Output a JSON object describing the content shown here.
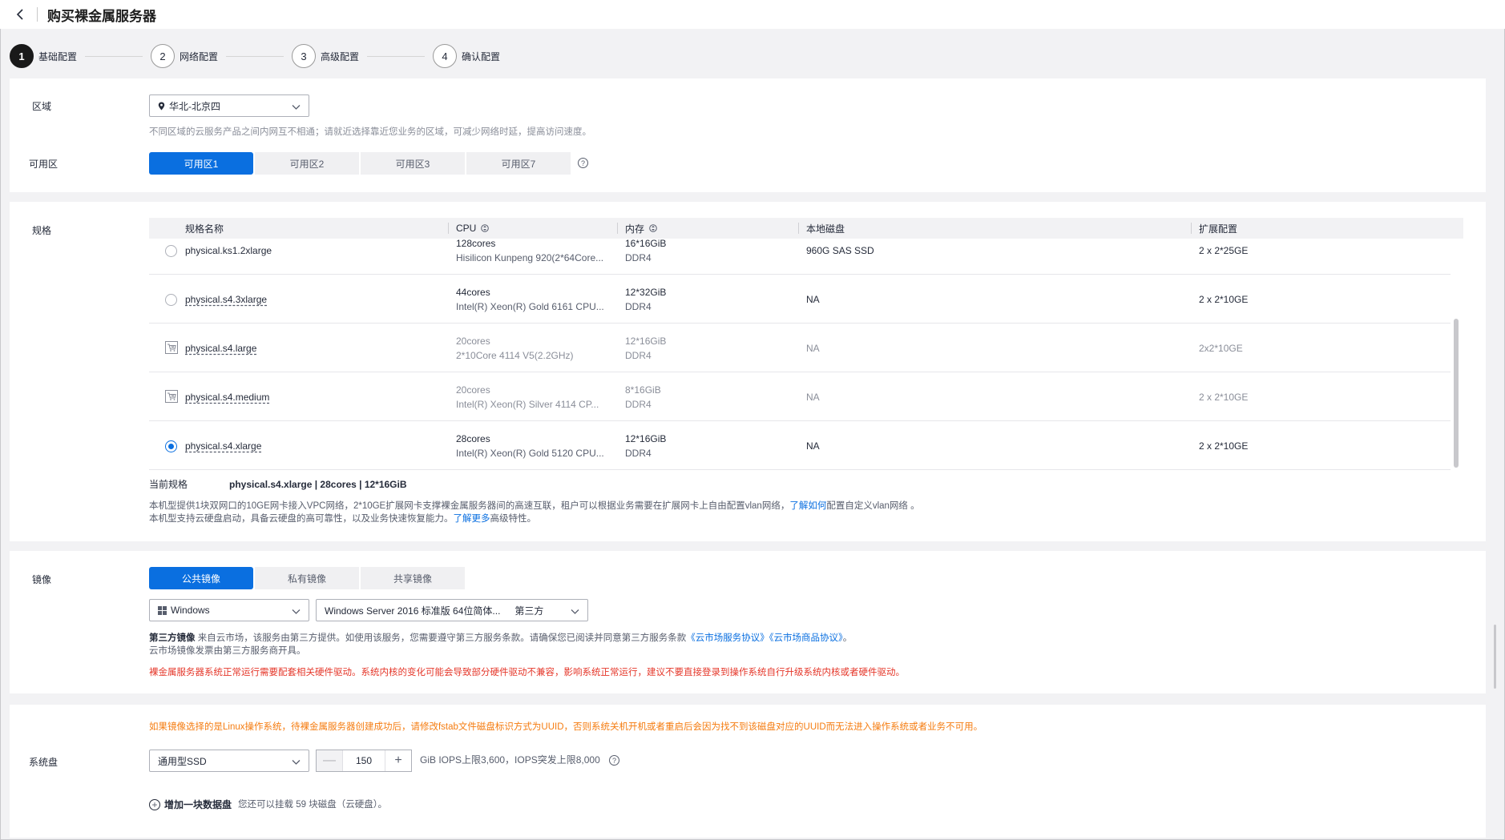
{
  "header": {
    "title": "购买裸金属服务器"
  },
  "steps": [
    {
      "num": "1",
      "label": "基础配置"
    },
    {
      "num": "2",
      "label": "网络配置"
    },
    {
      "num": "3",
      "label": "高级配置"
    },
    {
      "num": "4",
      "label": "确认配置"
    }
  ],
  "region": {
    "label": "区域",
    "value": "华北-北京四",
    "hint": "不同区域的云服务产品之间内网互不相通；请就近选择靠近您业务的区域，可减少网络时延，提高访问速度。"
  },
  "az": {
    "label": "可用区",
    "options": [
      "可用区1",
      "可用区2",
      "可用区3",
      "可用区7"
    ],
    "help": "?"
  },
  "spec": {
    "label": "规格",
    "columns": [
      "规格名称",
      "CPU",
      "内存",
      "本地磁盘",
      "扩展配置"
    ],
    "rows": [
      {
        "name": "physical.ks1.2xlarge",
        "cpu": "128cores",
        "cpu_sub": "Hisilicon Kunpeng 920(2*64Core...",
        "mem": "16*16GiB",
        "mem_sub": "DDR4",
        "disk": "960G SAS SSD",
        "ext": "2 x 2*25GE"
      },
      {
        "name": "physical.s4.3xlarge",
        "cpu": "44cores",
        "cpu_sub": "Intel(R) Xeon(R) Gold 6161 CPU...",
        "mem": "12*32GiB",
        "mem_sub": "DDR4",
        "disk": "NA",
        "ext": "2 x 2*10GE"
      },
      {
        "name": "physical.s4.large",
        "cpu": "20cores",
        "cpu_sub": "2*10Core 4114 V5(2.2GHz)",
        "mem": "12*16GiB",
        "mem_sub": "DDR4",
        "disk": "NA",
        "ext": "2x2*10GE"
      },
      {
        "name": "physical.s4.medium",
        "cpu": "20cores",
        "cpu_sub": "Intel(R) Xeon(R) Silver 4114 CP...",
        "mem": "8*16GiB",
        "mem_sub": "DDR4",
        "disk": "NA",
        "ext": "2 x 2*10GE"
      },
      {
        "name": "physical.s4.xlarge",
        "cpu": "28cores",
        "cpu_sub": "Intel(R) Xeon(R) Gold 5120 CPU...",
        "mem": "12*16GiB",
        "mem_sub": "DDR4",
        "disk": "NA",
        "ext": "2 x 2*10GE"
      }
    ],
    "current_label": "当前规格",
    "current_value": "physical.s4.xlarge | 28cores | 12*16GiB",
    "desc1_a": "本机型提供1块双网口的10GE网卡接入VPC网络，2*10GE扩展网卡支撑裸金属服务器间的高速互联，租户可以根据业务需要在扩展网卡上自由配置vlan网络，",
    "desc1_link": "了解如何",
    "desc1_b": "配置自定义vlan网络 。",
    "desc2_a": "本机型支持云硬盘启动，具备云硬盘的高可靠性，以及业务快速恢复能力。",
    "desc2_link": "了解更多",
    "desc2_b": "高级特性。"
  },
  "image": {
    "label": "镜像",
    "tabs": [
      "公共镜像",
      "私有镜像",
      "共享镜像"
    ],
    "os": "Windows",
    "version": "Windows Server 2016 标准版 64位简体...",
    "version_tag": "第三方",
    "third_bold": "第三方镜像",
    "third_text": " 来自云市场，该服务由第三方提供。如使用该服务，您需要遵守第三方服务条款。请确保您已阅读并同意第三方服务条款",
    "link1": "《云市场服务协议》",
    "link2": "《云市场商品协议》",
    "third_end": "。",
    "invoice": "云市场镜像发票由第三方服务商开具。",
    "red_warning": "裸金属服务器系统正常运行需要配套相关硬件驱动。系统内核的变化可能会导致部分硬件驱动不兼容，影响系统正常运行，建议不要直接登录到操作系统自行升级系统内核或者硬件驱动。"
  },
  "disk": {
    "orange_warning": "如果镜像选择的是Linux操作系统，待裸金属服务器创建成功后，请修改fstab文件磁盘标识方式为UUID，否则系统关机开机或者重启后会因为找不到该磁盘对应的UUID而无法进入操作系统或者业务不可用。",
    "label": "系统盘",
    "type": "通用型SSD",
    "size": "150",
    "iops": "GiB IOPS上限3,600，IOPS突发上限8,000",
    "add_label": "增加一块数据盘",
    "add_hint": "您还可以挂载 59 块磁盘（云硬盘）。"
  }
}
